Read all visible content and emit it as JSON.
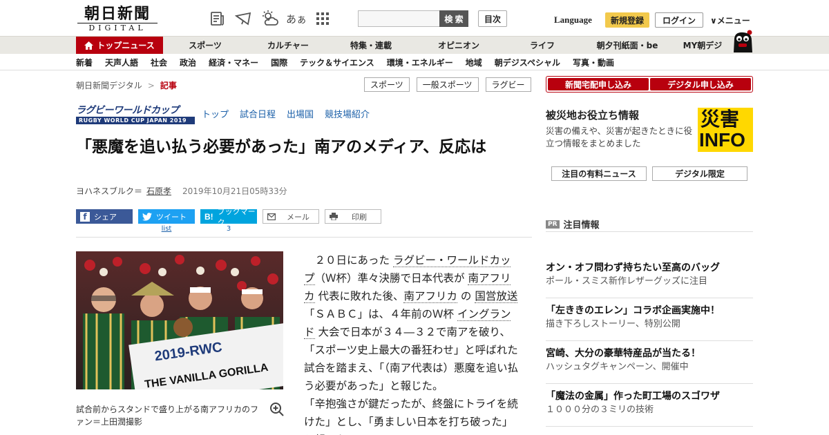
{
  "header": {
    "logo_title": "朝日新聞",
    "logo_sub": "DIGITAL",
    "font_size_label": "あぁ",
    "search": {
      "placeholder": "",
      "button": "検 索"
    },
    "mokuji": "目次",
    "language": "Language",
    "signup": "新規登録",
    "login": "ログイン",
    "menu": "∨メニュー"
  },
  "nav1": [
    {
      "label": "トップニュース",
      "active": true
    },
    {
      "label": "スポーツ"
    },
    {
      "label": "カルチャー"
    },
    {
      "label": "特集・連載"
    },
    {
      "label": "オピニオン"
    },
    {
      "label": "ライフ"
    },
    {
      "label": "朝夕刊紙面・be"
    },
    {
      "label": "MY朝デジ"
    }
  ],
  "nav2": [
    "新着",
    "天声人語",
    "社会",
    "政治",
    "経済・マネー",
    "国際",
    "テック＆サイエンス",
    "環境・エネルギー",
    "地域",
    "朝デジスペシャル",
    "写真・動画"
  ],
  "breadcrumb": {
    "home": "朝日新聞デジタル",
    "sep": ">",
    "current": "記事"
  },
  "tags": [
    "スポーツ",
    "一般スポーツ",
    "ラグビー"
  ],
  "rwc": {
    "logo_top": "ラグビーワールドカップ",
    "logo_bottom": "RUGBY WORLD CUP JAPAN 2019",
    "links": [
      "トップ",
      "試合日程",
      "出場国",
      "競技場紹介"
    ]
  },
  "article": {
    "headline": "「悪魔を追い払う必要があった」南アのメディア、反応は",
    "byline_place": "ヨハネスブルク＝",
    "byline_name": "石原孝",
    "date": "2019年10月21日05時33分",
    "photo_banner": "2019-RWC",
    "photo_banner2": "THE VANILLA GORILLA",
    "caption": "試合前からスタンドで盛り上がる南アフリカのファン＝上田潤撮影",
    "body": {
      "t1": "２０日にあった ",
      "l1": "ラグビー・ワールドカップ",
      "t2": "（Ｗ杯）準々決勝で日本代表が ",
      "l2": "南アフリカ",
      "t3": " 代表に敗れた後、",
      "l3": "南アフリカ",
      "t4": " の ",
      "l4": "国営放送",
      "t5": "「ＳＡＢＣ」は、４年前のＷ杯 ",
      "l5": "イングランド",
      "t6": " 大会で日本が３４―３２で南アを破り、「スポーツ史上最大の番狂わせ」と呼ばれた試合を踏まえ、「（南ア代表は）悪魔を追い払う必要があった」と報じた。",
      "t7": "「辛抱強さが鍵だったが、終盤にトライを続けた」とし、「勇ましい日本を打ち破った」と報じた。"
    }
  },
  "social": {
    "share": "シェア",
    "tweet": "ツイート",
    "tweet_count": "list",
    "bookmark": "ブックマーク",
    "bookmark_count": "3",
    "mail": "メール",
    "print": "印刷"
  },
  "sidebar": {
    "sub_home": "新聞宅配申し込み",
    "sub_digital": "デジタル申し込み",
    "saigai_title": "被災地お役立ち情報",
    "saigai_text": "災害の備えや、災害が起きたときに役立つ情報をまとめました",
    "saigai_kanji": "災害",
    "saigai_info": "INFO",
    "tab_news": "注目の有料ニュース",
    "tab_digital": "デジタル限定",
    "pr_badge": "PR",
    "pr_title": "注目情報",
    "pr_items": [
      {
        "title": "オン・オフ問わず持ちたい至高のバッグ",
        "sub": "ポール・スミス新作レザーグッズに注目"
      },
      {
        "title": "「左ききのエレン」コラボ企画実施中！",
        "sub": "描き下ろしストーリー、特別公開"
      },
      {
        "title": "宮崎、大分の豪華特産品が当たる！",
        "sub": "ハッシュタグキャンペーン、開催中"
      },
      {
        "title": "「魔法の金属」作った町工場のスゴワザ",
        "sub": "１０００分の３ミリの技術"
      }
    ]
  },
  "colors": {
    "brand_red": "#b8000e",
    "signup_yellow": "#f2c94c",
    "link_blue": "#1a5fa8",
    "rwc_navy": "#1f3b7a",
    "saigai_yellow": "#ffd800"
  }
}
